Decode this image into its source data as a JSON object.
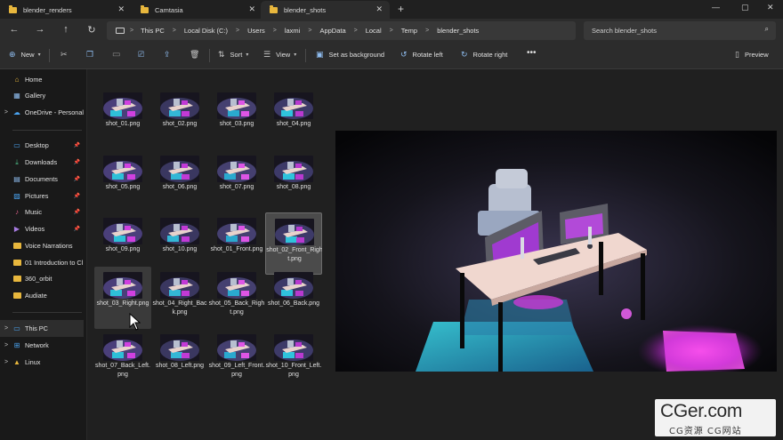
{
  "tabs": [
    {
      "label": "blender_renders",
      "active": false
    },
    {
      "label": "Camtasia",
      "active": false
    },
    {
      "label": "blender_shots",
      "active": true
    }
  ],
  "window_controls": {
    "minimize": "—",
    "maximize": "▢",
    "close": "✕",
    "new_tab": "+"
  },
  "nav": {
    "back": "←",
    "forward": "→",
    "up": "↑",
    "refresh": "↻"
  },
  "breadcrumbs": [
    "This PC",
    "Local Disk (C:)",
    "Users",
    "laxmi",
    "AppData",
    "Local",
    "Temp",
    "blender_shots"
  ],
  "search": {
    "placeholder": "Search blender_shots"
  },
  "toolbar": {
    "new": "New",
    "sort": "Sort",
    "view": "View",
    "set_background": "Set as background",
    "rotate_left": "Rotate left",
    "rotate_right": "Rotate right",
    "more": "•••",
    "preview": "Preview"
  },
  "sidebar": {
    "items": [
      {
        "label": "Home",
        "icon": "home-icon"
      },
      {
        "label": "Gallery",
        "icon": "gallery-icon"
      },
      {
        "label": "OneDrive - Personal",
        "icon": "cloud-icon"
      },
      {
        "label": "Desktop",
        "icon": "desktop-icon"
      },
      {
        "label": "Downloads",
        "icon": "download-icon"
      },
      {
        "label": "Documents",
        "icon": "documents-icon"
      },
      {
        "label": "Pictures",
        "icon": "pictures-icon"
      },
      {
        "label": "Music",
        "icon": "music-icon"
      },
      {
        "label": "Videos",
        "icon": "videos-icon"
      },
      {
        "label": "Voice Narrations",
        "icon": "folder-icon"
      },
      {
        "label": "01 Introduction to Cl",
        "icon": "folder-icon"
      },
      {
        "label": "360_orbit",
        "icon": "folder-icon"
      },
      {
        "label": "Audiate",
        "icon": "folder-icon"
      },
      {
        "label": "This PC",
        "icon": "this-pc-icon"
      },
      {
        "label": "Network",
        "icon": "network-icon"
      },
      {
        "label": "Linux",
        "icon": "linux-icon"
      }
    ]
  },
  "files": [
    {
      "name": "shot_01.png"
    },
    {
      "name": "shot_02.png"
    },
    {
      "name": "shot_03.png"
    },
    {
      "name": "shot_04.png"
    },
    {
      "name": "shot_05.png"
    },
    {
      "name": "shot_06.png"
    },
    {
      "name": "shot_07.png"
    },
    {
      "name": "shot_08.png"
    },
    {
      "name": "shot_09.png"
    },
    {
      "name": "shot_10.png"
    },
    {
      "name": "shot_01_Front.png"
    },
    {
      "name": "shot_02_Front_Right.png",
      "selected": true
    },
    {
      "name": "shot_03_Right.png",
      "hover": true
    },
    {
      "name": "shot_04_Right_Back.png"
    },
    {
      "name": "shot_05_Back_Right.png"
    },
    {
      "name": "shot_06_Back.png"
    },
    {
      "name": "shot_07_Back_Left.png"
    },
    {
      "name": "shot_08_Left.png"
    },
    {
      "name": "shot_09_Left_Front.png"
    },
    {
      "name": "shot_10_Front_Left.png"
    }
  ],
  "watermark": {
    "big": "CGer.com",
    "small": "CG资源 CG网站"
  },
  "colors": {
    "accent": "#8fbdf0",
    "folder": "#e8b73d",
    "neon_pink": "#e23fe0",
    "neon_cyan": "#34c6d8"
  }
}
